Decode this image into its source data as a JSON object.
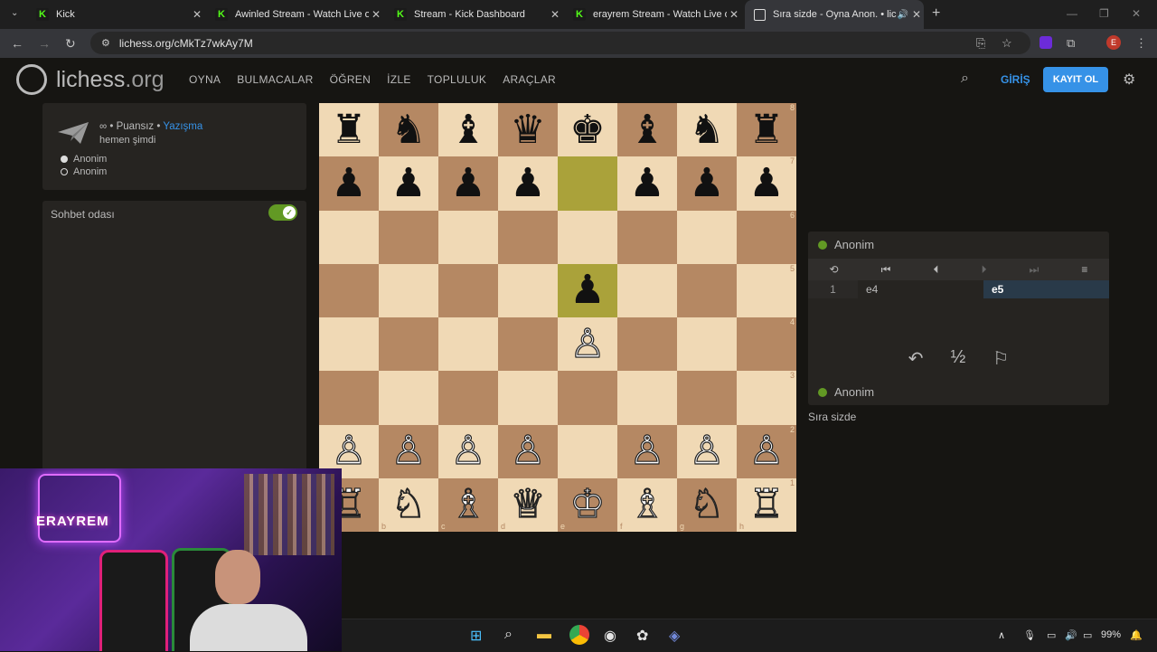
{
  "browser": {
    "tabs": [
      {
        "title": "Kick"
      },
      {
        "title": "Awinled Stream - Watch Live or"
      },
      {
        "title": "Stream - Kick Dashboard"
      },
      {
        "title": "erayrem Stream - Watch Live or"
      },
      {
        "title": "Sıra sizde - Oyna Anon. • lic"
      }
    ],
    "url": "lichess.org/cMkTz7wkAy7M",
    "profile_initial": "E"
  },
  "site": {
    "logo_name": "lichess",
    "logo_tld": ".org",
    "nav": [
      "OYNA",
      "BULMACALAR",
      "ÖĞREN",
      "İZLE",
      "TOPLULUK",
      "ARAÇLAR"
    ],
    "signin": "GİRİŞ",
    "signup": "KAYIT OL"
  },
  "game": {
    "setup_prefix": "∞ • Puansız • ",
    "setup_link": "Yazışma",
    "time": "hemen şimdi",
    "players": [
      "Anonim",
      "Anonim"
    ]
  },
  "chat": {
    "label": "Sohbet odası"
  },
  "board": {
    "ranks": [
      "8",
      "7",
      "6",
      "5",
      "4",
      "3",
      "2",
      "1"
    ],
    "files": [
      "a",
      "b",
      "c",
      "d",
      "e",
      "f",
      "g",
      "h"
    ],
    "position": [
      [
        "♜",
        "♞",
        "♝",
        "♛",
        "♚",
        "♝",
        "♞",
        "♜"
      ],
      [
        "♟",
        "♟",
        "♟",
        "♟",
        "",
        "♟",
        "♟",
        "♟"
      ],
      [
        "",
        "",
        "",
        "",
        "",
        "",
        "",
        ""
      ],
      [
        "",
        "",
        "",
        "",
        "♟",
        "",
        "",
        ""
      ],
      [
        "",
        "",
        "",
        "",
        "♙",
        "",
        "",
        ""
      ],
      [
        "",
        "",
        "",
        "",
        "",
        "",
        "",
        ""
      ],
      [
        "♙",
        "♙",
        "♙",
        "♙",
        "",
        "♙",
        "♙",
        "♙"
      ],
      [
        "♖",
        "♘",
        "♗",
        "♕",
        "♔",
        "♗",
        "♘",
        "♖"
      ]
    ]
  },
  "panel": {
    "top_player": "Anonim",
    "bottom_player": "Anonim",
    "moves": [
      {
        "num": "1",
        "white": "e4",
        "black": "e5"
      }
    ],
    "status": "Sıra sizde"
  },
  "webcam": {
    "brand_text": "ERAYREM"
  },
  "taskbar": {
    "battery": "99%"
  }
}
